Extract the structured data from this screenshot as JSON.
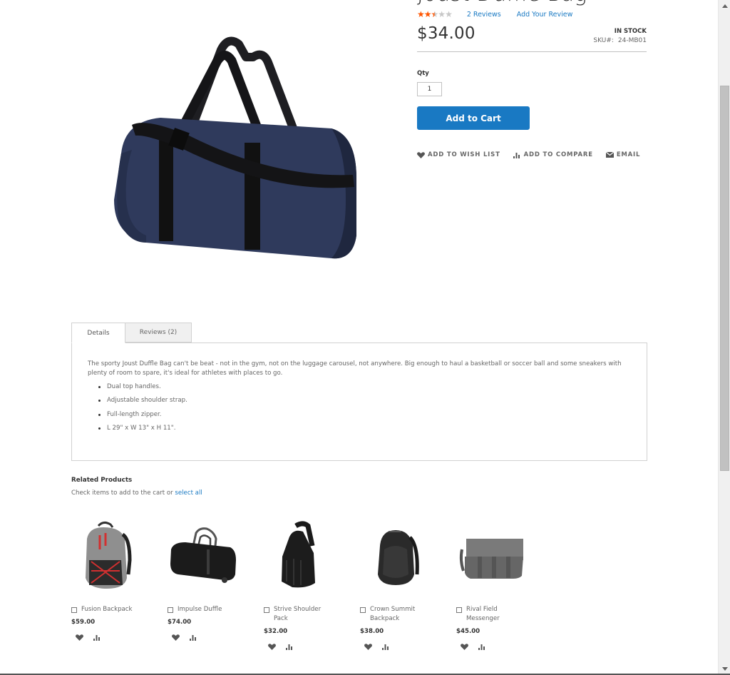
{
  "product": {
    "title": "Joust Duffle Bag",
    "rating": {
      "stars_filled": 2.5,
      "stars_total": 5,
      "reviews_link": "2  Reviews",
      "add_review_link": "Add Your Review"
    },
    "price": "$34.00",
    "stock_status": "IN STOCK",
    "sku_label": "SKU#:",
    "sku_value": "24-MB01",
    "qty_label": "Qty",
    "qty_value": "1",
    "add_to_cart_label": "Add to Cart",
    "actions": {
      "wishlist": "ADD TO WISH LIST",
      "compare": "ADD TO COMPARE",
      "email": "EMAIL"
    },
    "colors": {
      "accent": "#1979c3",
      "star_on": "#ff5501",
      "star_off": "#c7c7c7"
    }
  },
  "tabs": {
    "items": [
      {
        "label": "Details",
        "active": true
      },
      {
        "label": "Reviews (2)",
        "active": false
      }
    ],
    "details": {
      "description": "The sporty Joust Duffle Bag can't be beat - not in the gym, not on the luggage carousel, not anywhere. Big enough to haul a basketball or soccer ball and some sneakers with plenty of room to spare, it's ideal for athletes with places to go.",
      "features": [
        "Dual top handles.",
        "Adjustable shoulder strap.",
        "Full-length zipper.",
        "L 29\" x W 13\" x H 11\"."
      ]
    }
  },
  "related": {
    "title": "Related Products",
    "hint_text": "Check items to add to the cart or ",
    "select_all_label": "select all",
    "products": [
      {
        "name": "Fusion Backpack",
        "price": "$59.00",
        "image": "gray-red-backpack"
      },
      {
        "name": "Impulse Duffle",
        "price": "$74.00",
        "image": "black-rolling-duffle"
      },
      {
        "name": "Strive Shoulder Pack",
        "price": "$32.00",
        "image": "black-sling-pack"
      },
      {
        "name": "Crown Summit Backpack",
        "price": "$38.00",
        "image": "black-backpack"
      },
      {
        "name": "Rival Field Messenger",
        "price": "$45.00",
        "image": "gray-messenger-bag"
      }
    ]
  },
  "icons": {
    "wishlist": "heart-icon",
    "compare": "bar-chart-icon",
    "email": "envelope-icon",
    "scroll_up": "triangle-up-icon",
    "scroll_down": "triangle-down-icon"
  }
}
